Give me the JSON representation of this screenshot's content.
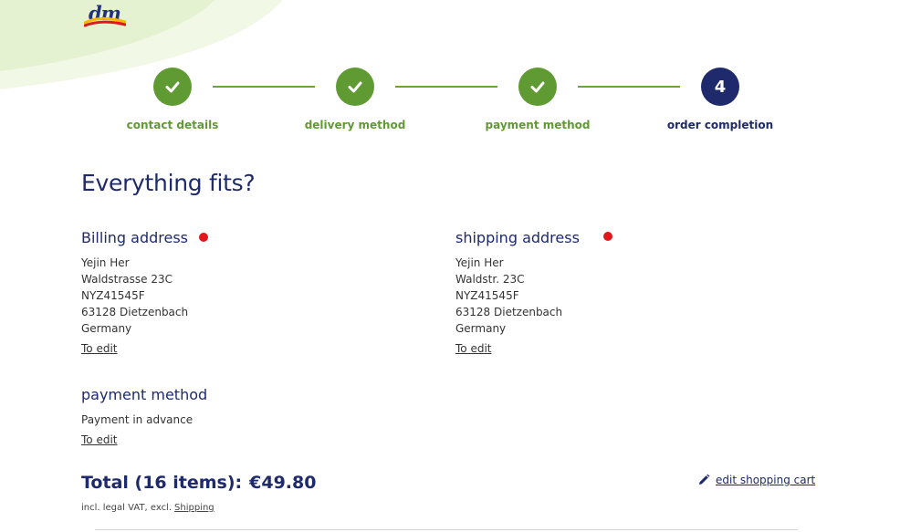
{
  "brand": {
    "logo_text": "dm"
  },
  "stepper": {
    "steps": [
      {
        "label": "contact details",
        "state": "done"
      },
      {
        "label": "delivery method",
        "state": "done"
      },
      {
        "label": "payment method",
        "state": "done"
      },
      {
        "label": "order completion",
        "state": "active",
        "number": "4"
      }
    ]
  },
  "page": {
    "title": "Everything fits?"
  },
  "billing": {
    "title": "Billing address",
    "lines": [
      "Yejin Her",
      "Waldstrasse 23C",
      "NYZ41545F",
      "63128 Dietzenbach",
      "Germany"
    ],
    "edit_label": "To edit"
  },
  "shipping": {
    "title": "shipping address",
    "lines": [
      "Yejin Her",
      "Waldstr. 23C",
      "NYZ41545F",
      "63128 Dietzenbach",
      "Germany"
    ],
    "edit_label": "To edit"
  },
  "payment": {
    "title": "payment method",
    "method": "Payment in advance",
    "edit_label": "To edit"
  },
  "summary": {
    "total_label": "Total (16 items):",
    "total_amount": "€49.80",
    "vat_text": "incl. legal VAT, excl.",
    "shipping_link": "Shipping",
    "edit_cart_label": "edit shopping cart"
  },
  "colors": {
    "brand_navy": "#1e2a6b",
    "step_done_green": "#5f9a32",
    "alert_red": "#e2171c"
  }
}
